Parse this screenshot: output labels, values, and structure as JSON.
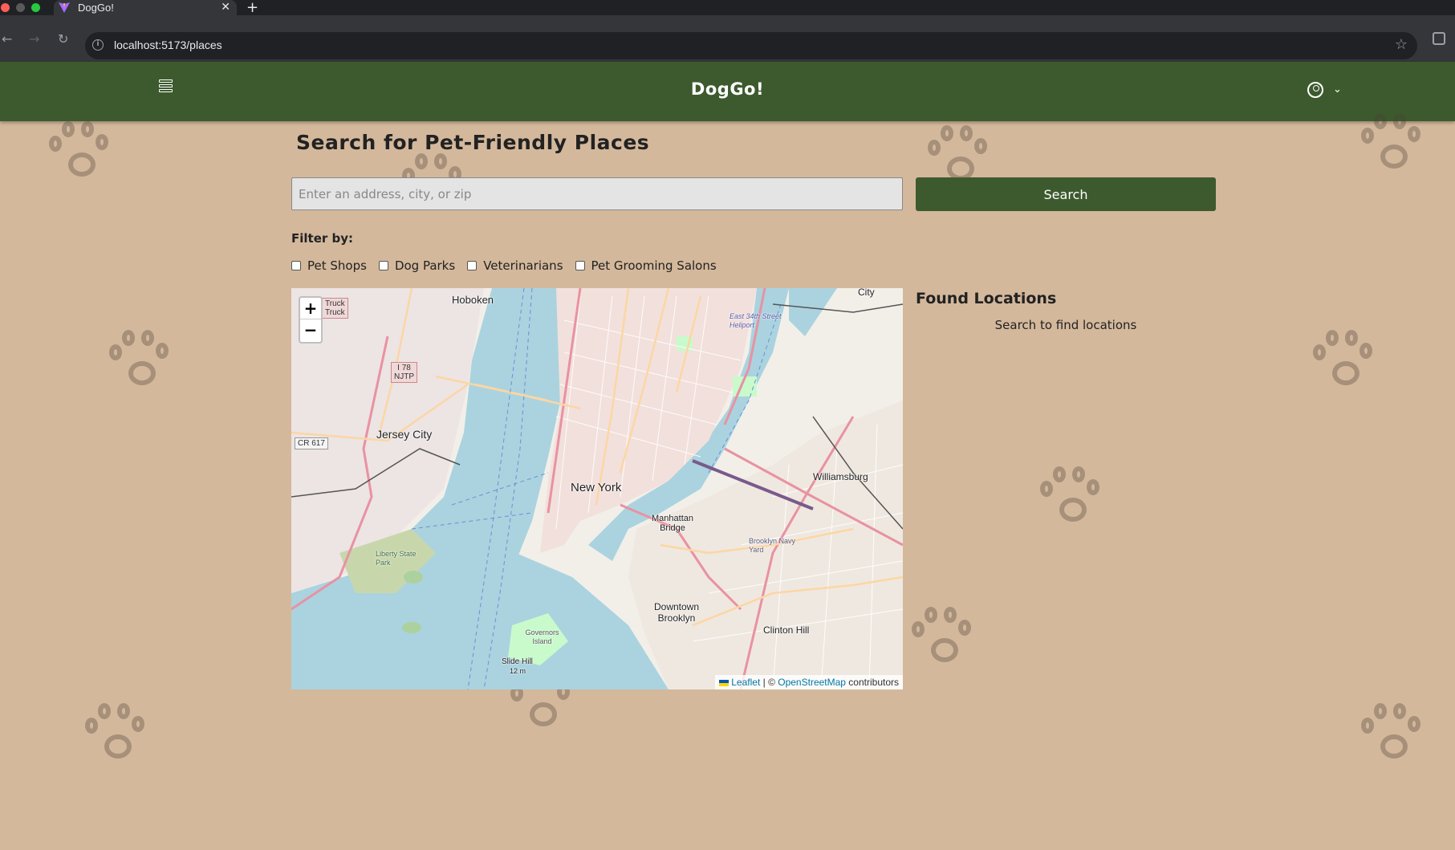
{
  "browser": {
    "tab_title": "DogGo!",
    "tab_close": "✕",
    "new_tab": "+",
    "url": "localhost:5173/places",
    "back": "←",
    "forward": "→",
    "reload": "↻",
    "info": "i",
    "star": "☆"
  },
  "header": {
    "brand": "DogGo!",
    "chevron": "⌄"
  },
  "main": {
    "title": "Search for Pet-Friendly Places",
    "search_placeholder": "Enter an address, city, or zip",
    "search_button": "Search",
    "filter_label": "Filter by:",
    "filters": [
      {
        "label": "Pet Shops",
        "checked": false
      },
      {
        "label": "Dog Parks",
        "checked": false
      },
      {
        "label": "Veterinarians",
        "checked": false
      },
      {
        "label": "Pet Grooming Salons",
        "checked": false
      }
    ],
    "found_title": "Found Locations",
    "found_empty": "Search to find locations"
  },
  "map": {
    "zoom_in": "+",
    "zoom_out": "−",
    "attribution_leaflet": "Leaflet",
    "attribution_sep": " | © ",
    "attribution_osm": "OpenStreetMap",
    "attribution_suffix": " contributors",
    "labels": {
      "hoboken": "Hoboken",
      "jersey_city": "Jersey City",
      "new_york": "New York",
      "manhattan_bridge": "Manhattan Bridge",
      "williamsburg": "Williamsburg",
      "downtown_brooklyn": "Downtown Brooklyn",
      "clinton_hill": "Clinton Hill",
      "brooklyn_navy_yard": "Brooklyn Navy Yard",
      "liberty_state_park": "Liberty State Park",
      "governors_island": "Governors Island",
      "slide_hill": "Slide Hill",
      "slide_hill_elev": "12 m",
      "heliport": "East 34th Street Heliport",
      "city": "City",
      "truck": "Truck",
      "truck2": "Truck",
      "i78": "I 78",
      "njtp": "NJTP",
      "cr617": "CR 617"
    }
  }
}
